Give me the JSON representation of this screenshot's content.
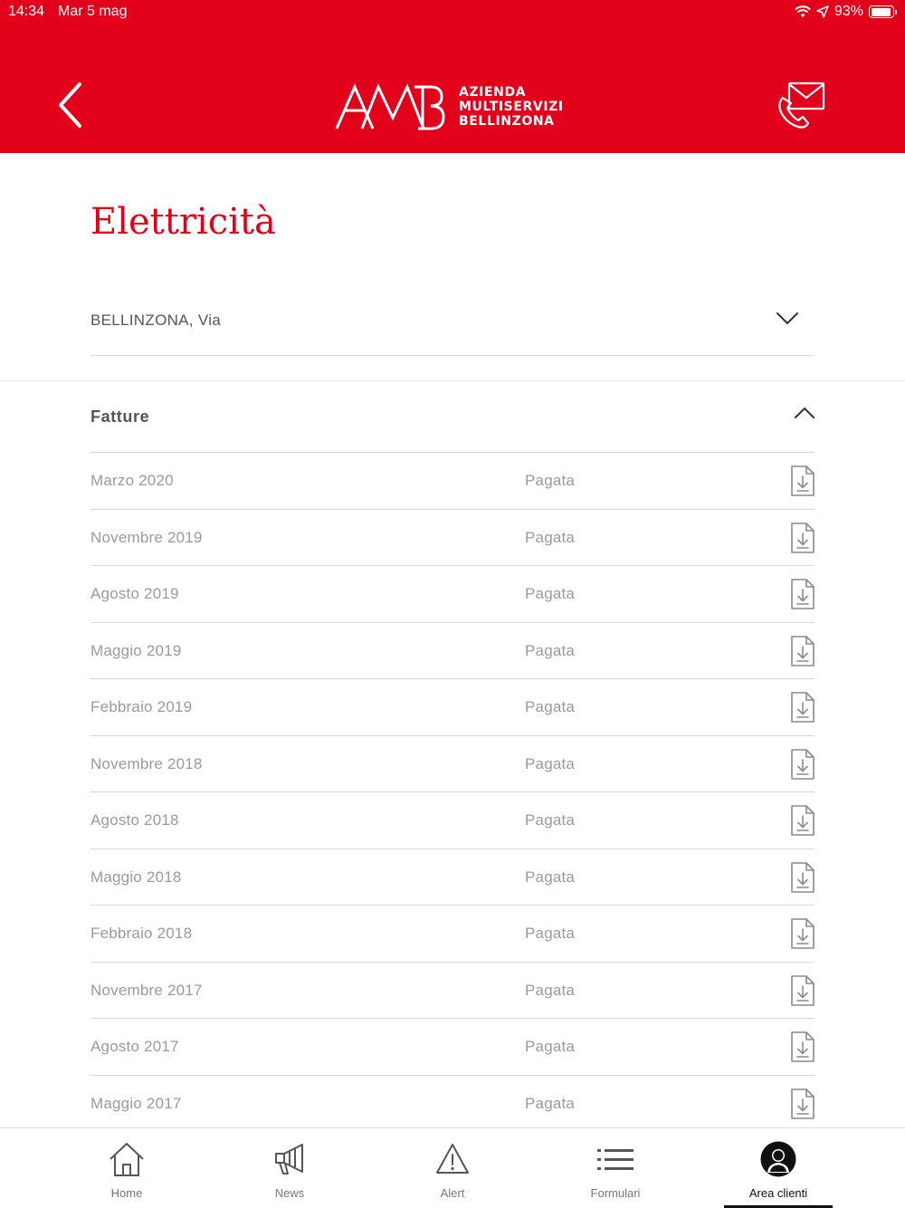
{
  "status_bar": {
    "time": "14:34",
    "date": "Mar 5 mag",
    "battery": "93%",
    "battery_level": 0.93
  },
  "header": {
    "logo_mark": "AMB",
    "logo_lines": [
      "AZIENDA",
      "MULTISERVIZI",
      "BELLINZONA"
    ],
    "brand_color": "#e2001a",
    "back_icon": "chevron-left-icon",
    "contact_icon": "phone-envelope-icon"
  },
  "page": {
    "title": "Elettricità",
    "address": "BELLINZONA, Via"
  },
  "invoices": {
    "section_label": "Fatture",
    "rows": [
      {
        "period": "Marzo 2020",
        "status": "Pagata"
      },
      {
        "period": "Novembre 2019",
        "status": "Pagata"
      },
      {
        "period": "Agosto 2019",
        "status": "Pagata"
      },
      {
        "period": "Maggio 2019",
        "status": "Pagata"
      },
      {
        "period": "Febbraio 2019",
        "status": "Pagata"
      },
      {
        "period": "Novembre 2018",
        "status": "Pagata"
      },
      {
        "period": "Agosto 2018",
        "status": "Pagata"
      },
      {
        "period": "Maggio 2018",
        "status": "Pagata"
      },
      {
        "period": "Febbraio 2018",
        "status": "Pagata"
      },
      {
        "period": "Novembre 2017",
        "status": "Pagata"
      },
      {
        "period": "Agosto 2017",
        "status": "Pagata"
      },
      {
        "period": "Maggio 2017",
        "status": "Pagata"
      }
    ]
  },
  "tabbar": {
    "tabs": [
      {
        "label": "Home",
        "icon": "home-icon",
        "active": false
      },
      {
        "label": "News",
        "icon": "megaphone-icon",
        "active": false
      },
      {
        "label": "Alert",
        "icon": "warning-icon",
        "active": false
      },
      {
        "label": "Formulari",
        "icon": "list-icon",
        "active": false
      },
      {
        "label": "Area clienti",
        "icon": "user-icon",
        "active": true
      }
    ]
  }
}
